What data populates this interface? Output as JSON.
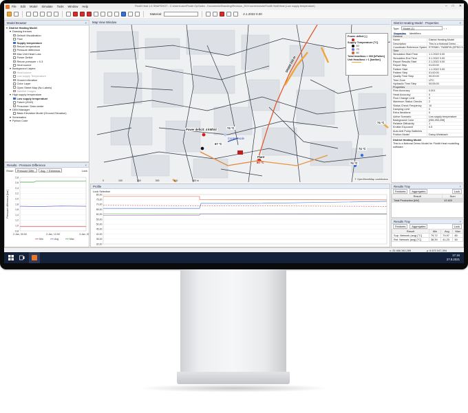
{
  "app": {
    "window_title": "Fluidit Heat 1.6 SNAPSHOT - C:\\Users\\user\\Fluidit Oy\\Sales - Documents\\Branding\\Revision_2021\\screenshots\\Fluidit Heat\\Heat (Low supply temperature)",
    "menu": [
      "File",
      "Edit",
      "Model",
      "Simulate",
      "Tools",
      "Window",
      "Help"
    ]
  },
  "toolbar": {
    "material_label": "Material:",
    "date": "2.1.2022 0.00"
  },
  "model_browser": {
    "title": "Model Browser",
    "items": [
      {
        "label": "District Heating Model",
        "indent": 0,
        "style": "bold",
        "toggle": "none"
      },
      {
        "label": "Drawing themes",
        "indent": 1,
        "style": "normal",
        "toggle": "none"
      },
      {
        "label": "Default Visualization",
        "indent": 2,
        "style": "normal",
        "toggle": "off"
      },
      {
        "label": "Flow",
        "indent": 2,
        "style": "normal",
        "toggle": "off"
      },
      {
        "label": "Supply temperature",
        "indent": 2,
        "style": "bold",
        "toggle": "on"
      },
      {
        "label": "Return temperature",
        "indent": 2,
        "style": "normal",
        "toggle": "off"
      },
      {
        "label": "Pressure difference",
        "indent": 2,
        "style": "normal",
        "toggle": "off"
      },
      {
        "label": "Max Unit Head Loss",
        "indent": 2,
        "style": "normal",
        "toggle": "off"
      },
      {
        "label": "Power Deficit",
        "indent": 2,
        "style": "normal",
        "toggle": "off"
      },
      {
        "label": "Return pressure < 0.3",
        "indent": 2,
        "style": "normal",
        "toggle": "off"
      },
      {
        "label": "Heat source",
        "indent": 2,
        "style": "normal",
        "toggle": "off"
      },
      {
        "label": "Background Layers",
        "indent": 1,
        "style": "normal",
        "toggle": "none"
      },
      {
        "label": "Heat source",
        "indent": 2,
        "style": "dim",
        "toggle": "off"
      },
      {
        "label": "Low supply Temperature",
        "indent": 2,
        "style": "dim",
        "toggle": "off"
      },
      {
        "label": "Ground elevation",
        "indent": 2,
        "style": "normal",
        "toggle": "off"
      },
      {
        "label": "Color Layer",
        "indent": 2,
        "style": "normal",
        "toggle": "off"
      },
      {
        "label": "Open Street Map (No Labels)",
        "indent": 2,
        "style": "normal",
        "toggle": "off"
      },
      {
        "label": "Satellite Images",
        "indent": 2,
        "style": "dim",
        "toggle": "off"
      },
      {
        "label": "High supply temperature",
        "indent": 1,
        "style": "normal",
        "toggle": "none"
      },
      {
        "label": "Low supply temperature",
        "indent": 2,
        "style": "bold",
        "toggle": "on"
      },
      {
        "label": "Future (2040)",
        "indent": 2,
        "style": "normal",
        "toggle": "off"
      },
      {
        "label": "Prosumer: Data center",
        "indent": 2,
        "style": "normal",
        "toggle": "off"
      },
      {
        "label": "DEM Manager",
        "indent": 1,
        "style": "normal",
        "toggle": "none"
      },
      {
        "label": "Basic Elevation Model (Ground Elevation)",
        "indent": 2,
        "style": "normal",
        "toggle": "off"
      },
      {
        "label": "Schematics",
        "indent": 1,
        "style": "normal",
        "toggle": "none"
      },
      {
        "label": "Python Code",
        "indent": 1,
        "style": "normal",
        "toggle": "none"
      }
    ]
  },
  "results_pd": {
    "title": "Results - Pressure Difference",
    "show_label": "Show:",
    "show_value": "Pressure Diffe...",
    "mode_value": "Avg. + Extremas",
    "lock": "Lock",
    "ylabel": "Pressure difference [bar]",
    "yticks": [
      "2,8",
      "2,6",
      "2,4",
      "2,2",
      "2,0",
      "1,8",
      "1,6",
      "1,4",
      "1,2",
      "1,0",
      "0,8"
    ],
    "xticks": [
      "2.Jan, 00:00",
      "2.Jan, 12:00",
      "3.Jan, 00:00"
    ],
    "legend": [
      "Min",
      "Avg",
      "Max"
    ]
  },
  "map": {
    "tab": "Map View Window",
    "legend": {
      "power_title": "Power deficit [-]",
      "temp_title": "Supply Temperature [°C]",
      "temps": [
        "60",
        "70",
        "80"
      ],
      "headloss_total": "Total headloss > 300 [kPa/km]",
      "headloss_unit": "Unit Headloss > 1 [bar/km]"
    },
    "labels": {
      "power_deficit": "Power deficit: 4 kWh/d",
      "t74a": "74 °C",
      "t67": "67 °C",
      "control_node": "Control node",
      "plant": "Plant",
      "plant_temp": "80 °C",
      "t74b": "74 °C",
      "t74c": "74 °C",
      "t74d": "74 °C",
      "pipe_label": "DN200 215 m",
      "copyright": "© OpenStreetMap contributors"
    },
    "scale": [
      "0",
      "100",
      "200",
      "300",
      "400",
      "500 m"
    ]
  },
  "properties": {
    "title": "District Heating Model - Properties",
    "type_label": "Type:",
    "type_value": "Model (1)",
    "tabs": [
      "Properties",
      "Identifiers"
    ],
    "rows": [
      {
        "type": "section",
        "label": "General"
      },
      {
        "type": "row",
        "k": "Name",
        "v": "District Heating Model"
      },
      {
        "type": "row",
        "k": "Description",
        "v": "This is a fictional Demo ..."
      },
      {
        "type": "row",
        "k": "Coordinate Reference System",
        "v": "ETRS89 / TM35FIN (EPSG:3..."
      },
      {
        "type": "section",
        "label": "Time"
      },
      {
        "type": "row",
        "k": "Simulation Start Time",
        "v": "1.1.2022 0.00"
      },
      {
        "type": "row",
        "k": "Simulation End Time",
        "v": "3.1.2022 0.00"
      },
      {
        "type": "row",
        "k": "Report Results Start",
        "v": "2.1.2022 0.00"
      },
      {
        "type": "row",
        "k": "Report Step",
        "v": "01:00:00"
      },
      {
        "type": "row",
        "k": "Pattern Start",
        "v": "1.1.2022 0.00"
      },
      {
        "type": "row",
        "k": "Pattern Step",
        "v": "01:00:00"
      },
      {
        "type": "row",
        "k": "Quality Time Step",
        "v": "00:20:00"
      },
      {
        "type": "row",
        "k": "Time Zone",
        "v": "UTC"
      },
      {
        "type": "row",
        "k": "Hydraulic Time Step",
        "v": "00:05:00"
      },
      {
        "type": "section",
        "label": "Properties"
      },
      {
        "type": "row",
        "k": "Flow Accuracy",
        "v": "0.001"
      },
      {
        "type": "row",
        "k": "Head Accuracy",
        "v": "0"
      },
      {
        "type": "row",
        "k": "Flow Change Limit",
        "v": "0"
      },
      {
        "type": "row",
        "k": "Maximum Status Checks",
        "v": "2"
      },
      {
        "type": "row",
        "k": "Status Check Frequency",
        "v": "10"
      },
      {
        "type": "row",
        "k": "Damping Limit",
        "v": "0"
      },
      {
        "type": "row",
        "k": "Extra Iterations",
        "v": "0"
      },
      {
        "type": "row",
        "k": "Active Scenario",
        "v": "Low supply temperature"
      },
      {
        "type": "row",
        "k": "Background Color",
        "v": "[255,255,255]"
      },
      {
        "type": "row",
        "k": "Relative Diffusivity",
        "v": "1"
      },
      {
        "type": "row",
        "k": "Emitter Exponent",
        "v": "0.5"
      },
      {
        "type": "row",
        "k": "Auto Anti Pump Batteries",
        "v": ""
      },
      {
        "type": "row",
        "k": "Friction Model",
        "v": "Darcy-Weisbach"
      }
    ],
    "desc_title": "District Heating Model",
    "desc_text": "This is a fictional Demo Model for Fluidit Heat modelling software."
  },
  "profile": {
    "tab": "Profile",
    "lock": "Lock Selection",
    "yticks": [
      "80,00",
      "75,00",
      "70,00",
      "65,00",
      "60,00",
      "55,00",
      "50,00",
      "45,00",
      "40,00",
      "35,00",
      "30,00"
    ]
  },
  "results_tray1": {
    "title": "Results Tray",
    "tabs": [
      "Features",
      "Aggregates"
    ],
    "lock": "Lock",
    "headers": [
      "Result",
      "Sum"
    ],
    "rows": [
      {
        "name": "Total Production [kW]",
        "v": "43 820"
      }
    ]
  },
  "results_tray2": {
    "title": "Results Tray",
    "tabs": [
      "Features",
      "Aggregates"
    ],
    "lock": "Lock",
    "headers": [
      "Result",
      "Min",
      "Avg",
      "Max"
    ],
    "rows": [
      {
        "name": "Sup. Network (avg) [°C]",
        "min": "79,72",
        "avg": "79,97",
        "max": "80"
      },
      {
        "name": "Ret. Network (avg) [°C]",
        "min": "38,39",
        "avg": "41,23",
        "max": "50"
      }
    ]
  },
  "status": {
    "coords": "x: 25 466 340,289",
    "coords2": "y: 6 670 047,394"
  },
  "taskbar": {
    "time": "17.16",
    "date": "27.8.2021"
  }
}
